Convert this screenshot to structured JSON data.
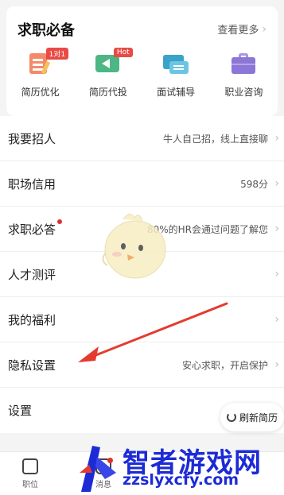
{
  "card": {
    "title": "求职必备",
    "more_label": "查看更多",
    "tools": [
      {
        "label": "简历优化",
        "icon": "resume-optimize-icon",
        "tag": "1对1"
      },
      {
        "label": "简历代投",
        "icon": "resume-delivery-icon",
        "tag": "Hot"
      },
      {
        "label": "面试辅导",
        "icon": "interview-coaching-icon",
        "tag": ""
      },
      {
        "label": "职业咨询",
        "icon": "career-consult-icon",
        "tag": ""
      }
    ]
  },
  "rows": [
    {
      "label": "我要招人",
      "value": "牛人自己招，线上直接聊"
    },
    {
      "label": "职场信用",
      "value": "598分"
    },
    {
      "label": "求职必答",
      "value": "80%的HR会通过问题了解您"
    },
    {
      "label": "人才测评",
      "value": ""
    },
    {
      "label": "我的福利",
      "value": ""
    },
    {
      "label": "隐私设置",
      "value": "安心求职，开启保护"
    },
    {
      "label": "设置",
      "value": ""
    }
  ],
  "refresh_button": "刷新简历",
  "tabbar": {
    "tabs": [
      {
        "label": "职位"
      },
      {
        "label": "消息"
      }
    ]
  },
  "watermark": {
    "name": "智者游戏网",
    "url": "zzslyxcfy.com"
  },
  "colors": {
    "accent_red": "#e03131",
    "annotation_red": "#e53b2f",
    "watermark_blue": "#1d2bd6"
  }
}
